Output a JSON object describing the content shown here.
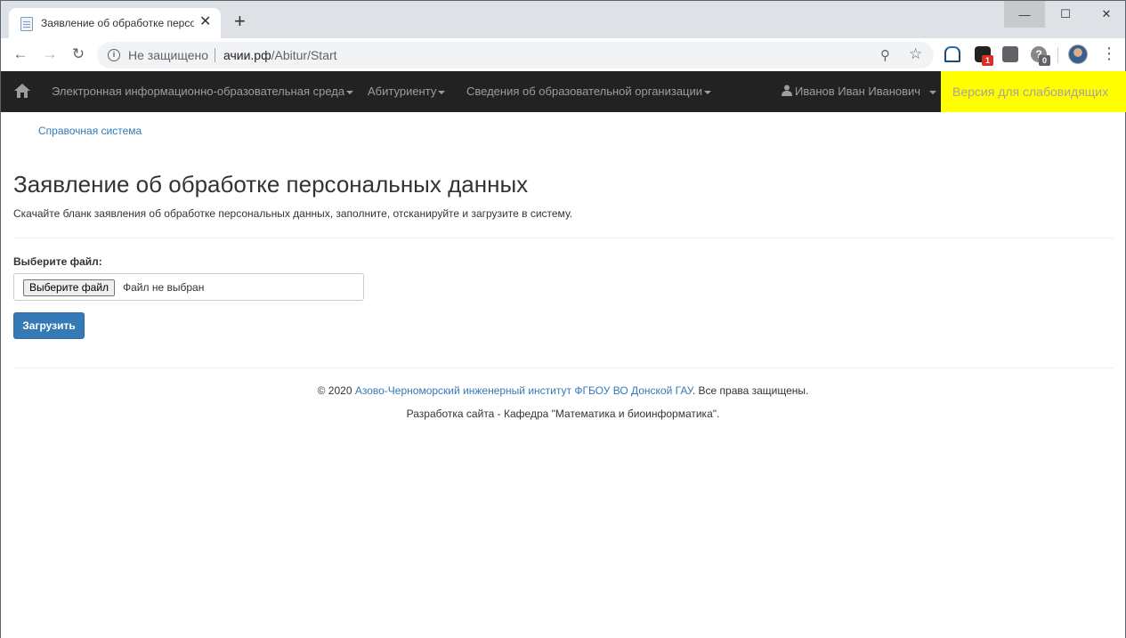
{
  "browser": {
    "tab_title": "Заявление об обработке персо",
    "new_tab_label": "+",
    "omnibox": {
      "security_text": "Не защищено",
      "url_host": "ачии.рф",
      "url_path": "/Abitur/Start"
    },
    "extensions": {
      "badge_1": "1",
      "badge_2": "0"
    }
  },
  "navbar": {
    "items": [
      {
        "label": "Электронная информационно-образовательная среда"
      },
      {
        "label": "Абитуриенту"
      },
      {
        "label": "Сведения об образовательной организации"
      }
    ],
    "user_name": "Иванов Иван Иванович",
    "low_vision_label": "Версия для слабовидящих"
  },
  "page": {
    "help_link": "Справочная система",
    "title": "Заявление об обработке персональных данных",
    "intro": "Скачайте бланк заявления об обработке персональных данных, заполните, отсканируйте и загрузите в систему.",
    "file_label": "Выберите файл:",
    "file_button": "Выберите файл",
    "file_status": "Файл не выбран",
    "upload_button": "Загрузить"
  },
  "footer": {
    "copyright_prefix": "© 2020 ",
    "institute_link": "Азово-Черноморский инженерный институт ФГБОУ ВО Донской ГАУ",
    "rights": ". Все права защищены.",
    "development": "Разработка сайта - Кафедра \"Математика и биоинформатика\"."
  },
  "colors": {
    "navbar_bg": "#222222",
    "accent_link": "#337ab7",
    "low_vision_bg": "#ffff00",
    "primary_button": "#337ab7"
  }
}
